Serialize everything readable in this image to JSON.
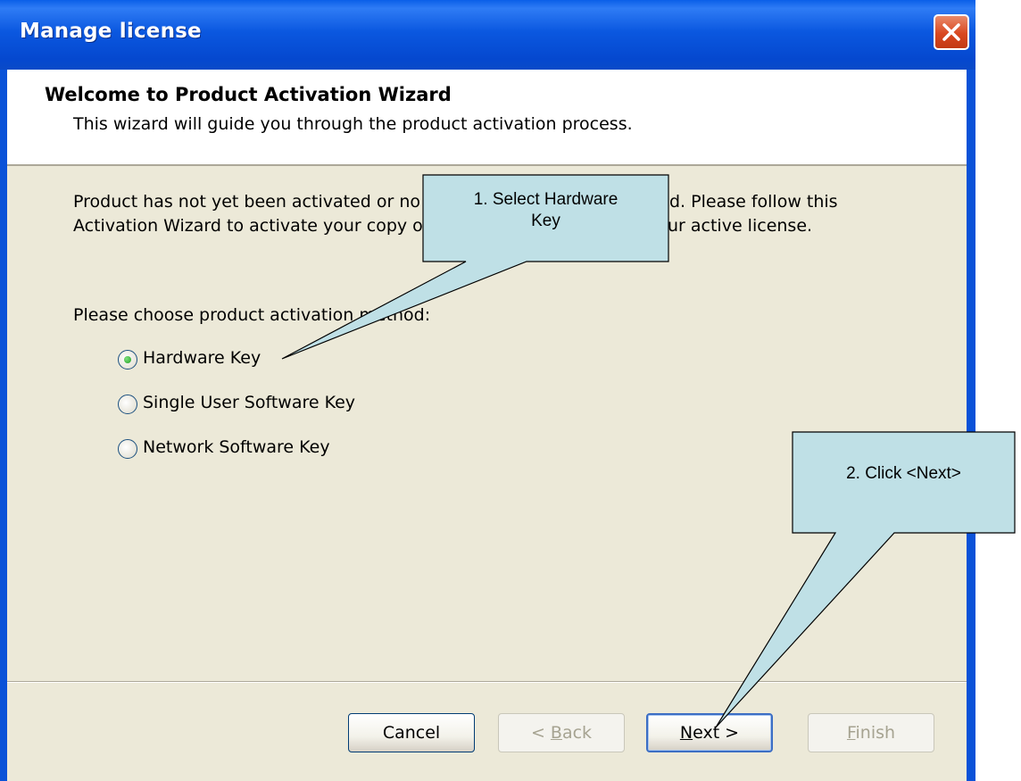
{
  "window": {
    "title": "Manage license",
    "close_icon": "close-icon"
  },
  "header": {
    "title": "Welcome to Product Activation Wizard",
    "subtitle": "This wizard will guide you through the product activation process."
  },
  "body": {
    "intro_line1": "Product has not yet been activated or no",
    "intro_line1_end": "d. Please follow this",
    "intro_line2": "Activation Wizard to activate your copy o",
    "intro_line2_end": "ur active license.",
    "choose_label_a": "Please choose product activation m",
    "choose_label_b": "ethod:"
  },
  "activation_methods": [
    {
      "label": "Hardware Key",
      "checked": true
    },
    {
      "label": "Single User Software Key",
      "checked": false
    },
    {
      "label": "Network Software Key",
      "checked": false
    }
  ],
  "buttons": {
    "cancel": "Cancel",
    "back_prefix": "< ",
    "back_access": "B",
    "back_rest": "ack",
    "next_access": "N",
    "next_rest": "ext >",
    "finish_access": "F",
    "finish_rest": "inish"
  },
  "callouts": {
    "step1_line1": "1. Select Hardware",
    "step1_line2": "Key",
    "step2": "2. Click <Next>",
    "fill_color": "#bfe0e6"
  },
  "colors": {
    "titlebar": "#0b58e0",
    "dialog_bg": "#ece9d8",
    "close_button": "#d94820"
  }
}
